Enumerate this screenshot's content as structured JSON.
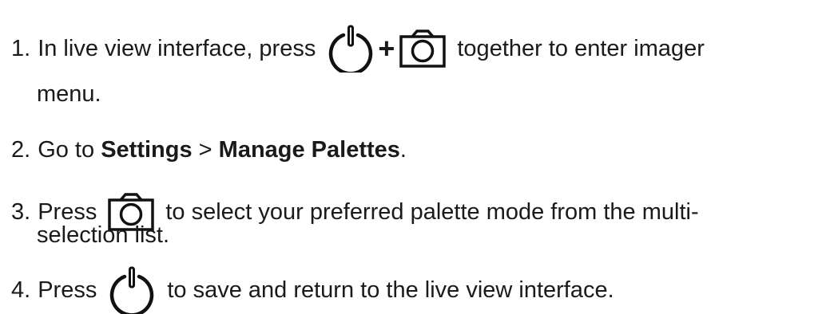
{
  "steps": [
    {
      "number": "1.",
      "text_before": "In live view interface, press",
      "icon_1": "power-icon",
      "connector": "+",
      "icon_2": "camera-icon",
      "text_after": "together to enter imager",
      "continuation": "menu."
    },
    {
      "number": "2.",
      "text_before": "Go to",
      "bold_1": "Settings",
      "separator": ">",
      "bold_2": "Manage Palettes",
      "text_after": "."
    },
    {
      "number": "3.",
      "text_before": "Press",
      "icon": "camera-icon",
      "text_after": "to select your preferred palette mode from the multi-",
      "continuation": "selection list."
    },
    {
      "number": "4.",
      "text_before": "Press",
      "icon": "power-icon",
      "text_after": "to save and return to the live view interface."
    }
  ]
}
